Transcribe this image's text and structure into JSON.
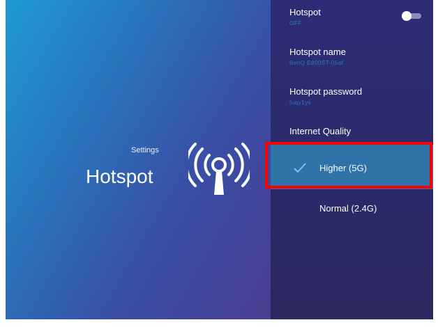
{
  "header": {
    "settings_label": "Settings",
    "title": "Hotspot",
    "icon": "hotspot-antenna-icon"
  },
  "menu": {
    "hotspot": {
      "label": "Hotspot",
      "state": "OFF"
    },
    "hotspot_name": {
      "label": "Hotspot name",
      "value": "BenQ E800ST-05af"
    },
    "hotspot_password": {
      "label": "Hotspot password",
      "value": "fuqy1yv"
    },
    "internet_quality": {
      "label": "Internet Quality",
      "options": [
        {
          "label": "Higher (5G)",
          "selected": true
        },
        {
          "label": "Normal (2.4G)",
          "selected": false
        }
      ]
    }
  },
  "colors": {
    "selected_bg": "#2f74a9",
    "highlight": "#ff0000",
    "subtext": "#2f77c8"
  }
}
